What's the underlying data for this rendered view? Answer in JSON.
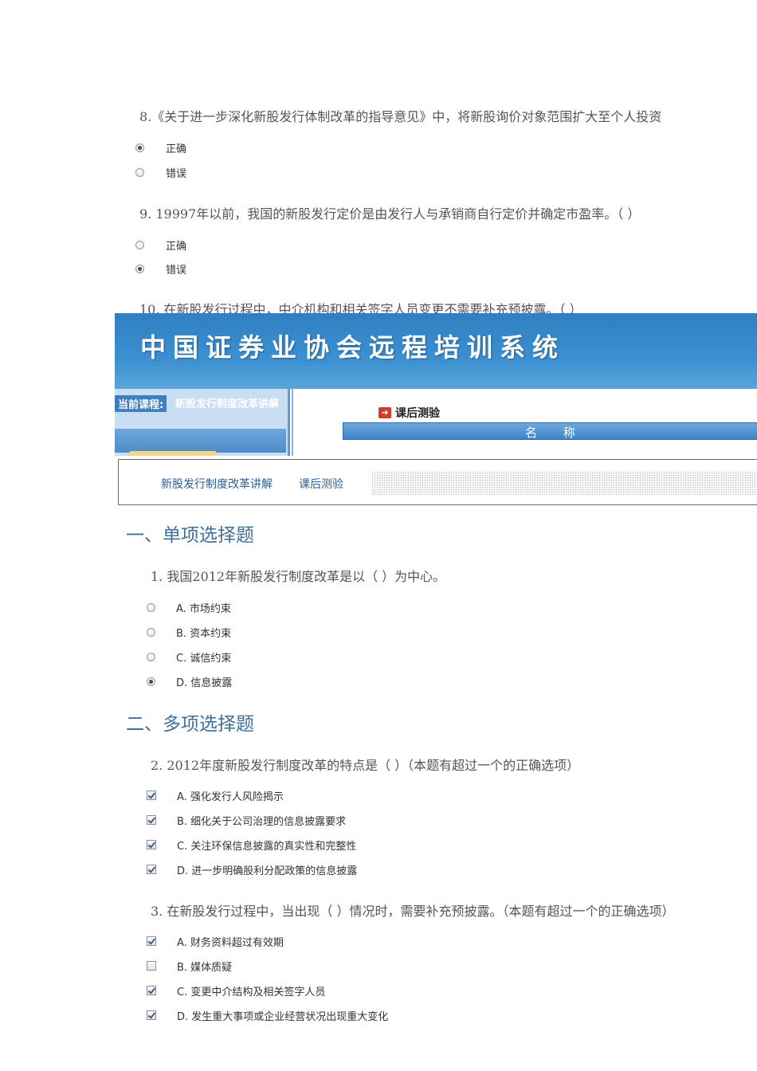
{
  "top": {
    "q8": {
      "text": "8.《关于进一步深化新股发行体制改革的指导意见》中，将新股询价对象范围扩大至个人投资",
      "options": [
        {
          "label": "正确",
          "selected": true
        },
        {
          "label": "错误",
          "selected": false
        }
      ]
    },
    "q9": {
      "text": "9. 19997年以前，我国的新股发行定价是由发行人与承销商自行定价并确定市盈率。（ ）",
      "options": [
        {
          "label": "正确",
          "selected": false
        },
        {
          "label": "错误",
          "selected": true
        }
      ]
    },
    "q10": {
      "text": "10. 在新股发行过程中，中介机构和相关签字人员变更不需要补充预披露。（ ）"
    }
  },
  "banner": {
    "title": "中国证券业协会远程培训系统"
  },
  "course_panel": {
    "label": "当前课程:",
    "name": "新股发行制度改革讲解"
  },
  "quiz_panel": {
    "icon": "➜",
    "title": "课后测验",
    "column_name": "名 称"
  },
  "breadcrumb": {
    "course": "新股发行制度改革讲解",
    "page": "课后测验"
  },
  "section1": {
    "title": "一、单项选择题",
    "q1": {
      "text": "1. 我国2012年新股发行制度改革是以（ ）为中心。",
      "options": [
        {
          "label": "A. 市场约束",
          "selected": false
        },
        {
          "label": "B. 资本约束",
          "selected": false
        },
        {
          "label": "C. 诚信约束",
          "selected": false
        },
        {
          "label": "D. 信息披露",
          "selected": true
        }
      ]
    }
  },
  "section2": {
    "title": "二、多项选择题",
    "q2": {
      "text": "2. 2012年度新股发行制度改革的特点是（ ）（本题有超过一个的正确选项）",
      "options": [
        {
          "label": "A. 强化发行人风险揭示",
          "checked": true
        },
        {
          "label": "B. 细化关于公司治理的信息披露要求",
          "checked": true
        },
        {
          "label": "C. 关注环保信息披露的真实性和完整性",
          "checked": true
        },
        {
          "label": "D. 进一步明确股利分配政策的信息披露",
          "checked": true
        }
      ]
    },
    "q3": {
      "text": "3. 在新股发行过程中，当出现（ ）情况时，需要补充预披露。（本题有超过一个的正确选项）",
      "options": [
        {
          "label": "A. 财务资料超过有效期",
          "checked": true
        },
        {
          "label": "B. 媒体质疑",
          "checked": false
        },
        {
          "label": "C. 变更中介结构及相关签字人员",
          "checked": true
        },
        {
          "label": "D. 发生重大事项或企业经营状况出现重大变化",
          "checked": true
        }
      ]
    }
  }
}
